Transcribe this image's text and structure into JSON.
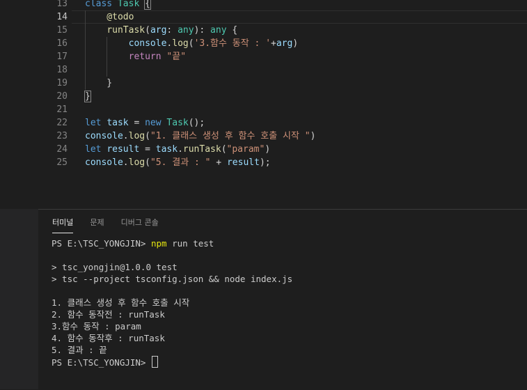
{
  "editor": {
    "active_line": "14",
    "lines": [
      {
        "num": "13",
        "tokens": [
          {
            "t": "class ",
            "c": "kw"
          },
          {
            "t": "Task",
            "c": "cls"
          },
          {
            "t": " "
          },
          {
            "t": "{",
            "c": "brk"
          }
        ]
      },
      {
        "num": "14",
        "tokens": [
          {
            "t": "    @todo",
            "c": "fn"
          }
        ]
      },
      {
        "num": "15",
        "tokens": [
          {
            "t": "    "
          },
          {
            "t": "runTask",
            "c": "fn"
          },
          {
            "t": "("
          },
          {
            "t": "arg",
            "c": "var"
          },
          {
            "t": ": "
          },
          {
            "t": "any",
            "c": "cls"
          },
          {
            "t": "): "
          },
          {
            "t": "any",
            "c": "cls"
          },
          {
            "t": " {"
          }
        ]
      },
      {
        "num": "16",
        "tokens": [
          {
            "t": "        "
          },
          {
            "t": "console",
            "c": "var"
          },
          {
            "t": "."
          },
          {
            "t": "log",
            "c": "fn"
          },
          {
            "t": "("
          },
          {
            "t": "'3.함수 동작 : '",
            "c": "str"
          },
          {
            "t": "+"
          },
          {
            "t": "arg",
            "c": "var"
          },
          {
            "t": ")"
          }
        ]
      },
      {
        "num": "17",
        "tokens": [
          {
            "t": "        "
          },
          {
            "t": "return",
            "c": "ctl"
          },
          {
            "t": " "
          },
          {
            "t": "\"끝\"",
            "c": "str"
          }
        ]
      },
      {
        "num": "18",
        "tokens": []
      },
      {
        "num": "19",
        "tokens": [
          {
            "t": "    }"
          }
        ]
      },
      {
        "num": "20",
        "tokens": [
          {
            "t": "}",
            "c": "brk"
          }
        ]
      },
      {
        "num": "21",
        "tokens": []
      },
      {
        "num": "22",
        "tokens": [
          {
            "t": "let",
            "c": "kw"
          },
          {
            "t": " "
          },
          {
            "t": "task",
            "c": "var"
          },
          {
            "t": " = "
          },
          {
            "t": "new",
            "c": "kw"
          },
          {
            "t": " "
          },
          {
            "t": "Task",
            "c": "cls"
          },
          {
            "t": "();"
          }
        ]
      },
      {
        "num": "23",
        "tokens": [
          {
            "t": "console",
            "c": "var"
          },
          {
            "t": "."
          },
          {
            "t": "log",
            "c": "fn"
          },
          {
            "t": "("
          },
          {
            "t": "\"1. 클래스 생성 후 함수 호출 시작 \"",
            "c": "str"
          },
          {
            "t": ")"
          }
        ]
      },
      {
        "num": "24",
        "tokens": [
          {
            "t": "let",
            "c": "kw"
          },
          {
            "t": " "
          },
          {
            "t": "result",
            "c": "var"
          },
          {
            "t": " = "
          },
          {
            "t": "task",
            "c": "var"
          },
          {
            "t": "."
          },
          {
            "t": "runTask",
            "c": "fn"
          },
          {
            "t": "("
          },
          {
            "t": "\"param\"",
            "c": "str"
          },
          {
            "t": ")"
          }
        ]
      },
      {
        "num": "25",
        "tokens": [
          {
            "t": "console",
            "c": "var"
          },
          {
            "t": "."
          },
          {
            "t": "log",
            "c": "fn"
          },
          {
            "t": "("
          },
          {
            "t": "\"5. 결과 : \"",
            "c": "str"
          },
          {
            "t": " + "
          },
          {
            "t": "result",
            "c": "var"
          },
          {
            "t": ");"
          }
        ]
      }
    ]
  },
  "panel": {
    "tabs": [
      "터미널",
      "문제",
      "디버그 콘솔"
    ],
    "active_tab": "터미널"
  },
  "terminal": {
    "prompt": "PS E:\\TSC_YONGJIN> ",
    "command_npm": "npm",
    "command_rest": " run test",
    "lines": [
      "",
      "> tsc_yongjin@1.0.0 test",
      "> tsc --project tsconfig.json && node index.js",
      "",
      "1. 클래스 생성 후 함수 호출 시작",
      "2. 함수 동작전 : runTask",
      "3.함수 동작 : param",
      "4. 함수 동작후 : runTask",
      "5. 결과 : 끝"
    ],
    "final_prompt": "PS E:\\TSC_YONGJIN> "
  }
}
